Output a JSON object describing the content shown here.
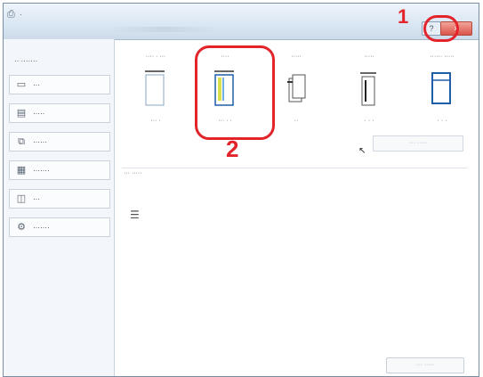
{
  "window": {
    "title": "·",
    "help_label": "?",
    "close_label": "×"
  },
  "callouts": {
    "one": "1",
    "two": "2"
  },
  "sidebar": {
    "header": "·· ·······",
    "items": [
      {
        "label": "···",
        "icon": "page-icon"
      },
      {
        "label": "·····",
        "icon": "layout-icon"
      },
      {
        "label": "······",
        "icon": "finishing-icon"
      },
      {
        "label": "·······",
        "icon": "color-icon"
      },
      {
        "label": "···",
        "icon": "image-icon"
      },
      {
        "label": "·······",
        "icon": "advanced-icon"
      }
    ]
  },
  "options": [
    {
      "caption": "···· · ···",
      "sub": "··· ·",
      "icon": "doc-icon"
    },
    {
      "caption": "····",
      "sub": "··· · ·",
      "icon": "doc-selected-icon"
    },
    {
      "caption": "·····",
      "sub": "··",
      "icon": "staple-icon"
    },
    {
      "caption": "·····",
      "sub": "· · ·",
      "icon": "book-icon"
    },
    {
      "caption": "······ ·····",
      "sub": "· · ·",
      "icon": "frame-icon"
    }
  ],
  "section_label": "··· ·····",
  "small_button": "··· ·····",
  "bottom_button": "··· ·····",
  "colors": {
    "accent": "#e3242b",
    "title": "#d9e6f3"
  }
}
